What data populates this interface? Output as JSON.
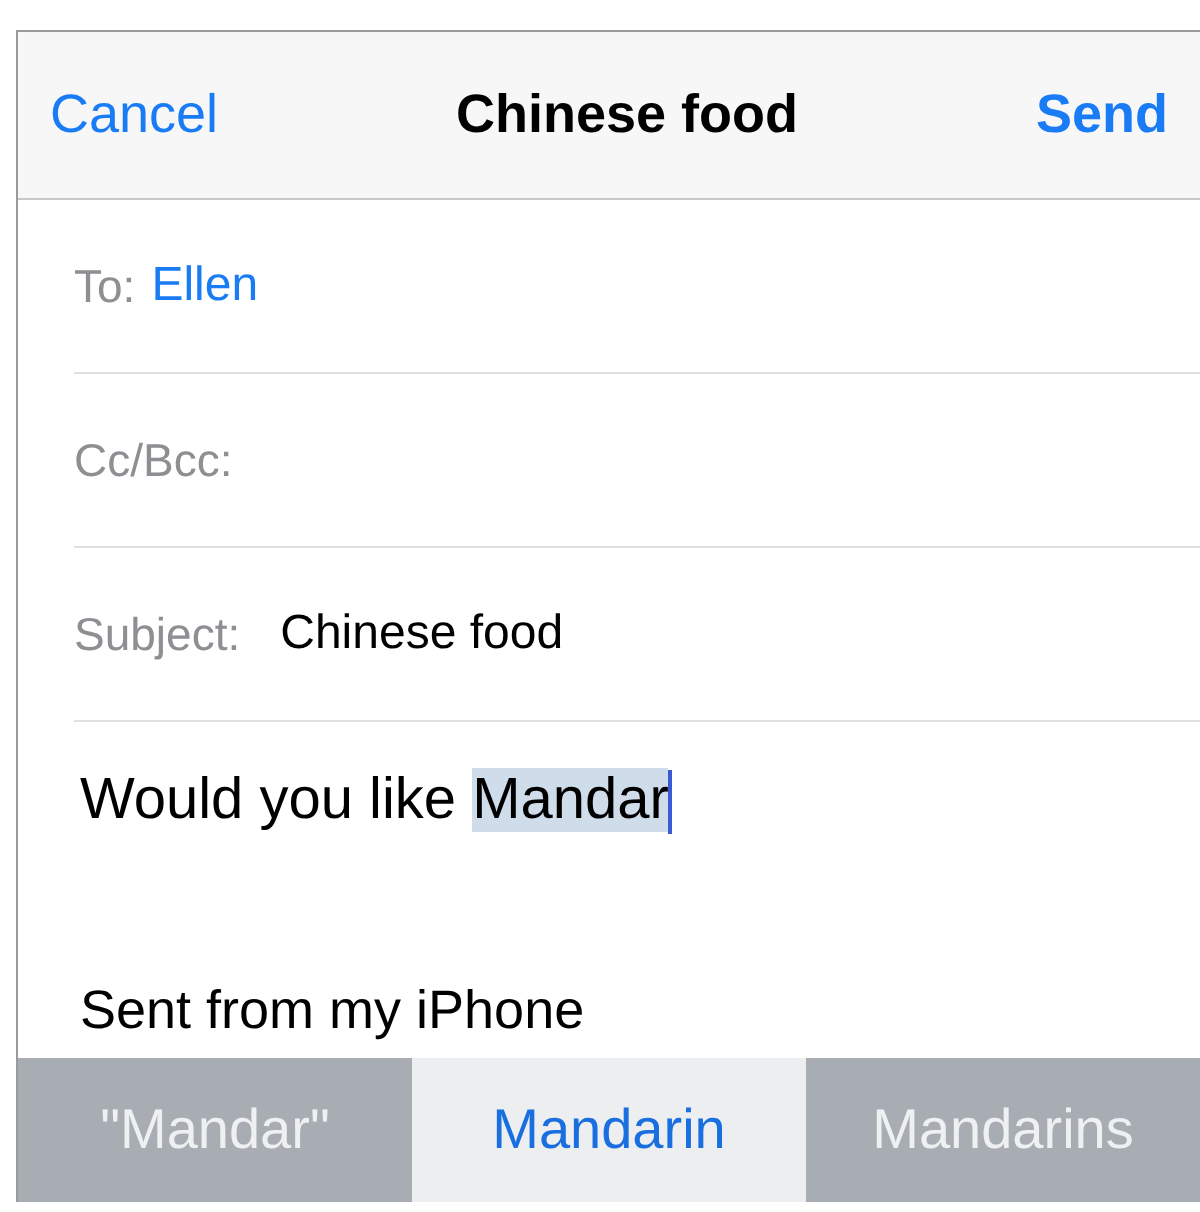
{
  "nav": {
    "cancel": "Cancel",
    "title": "Chinese food",
    "send": "Send"
  },
  "fields": [
    {
      "label": "To:",
      "value": "Ellen",
      "kind": "recipient"
    },
    {
      "label": "Cc/Bcc:",
      "kind": "recipient"
    },
    {
      "label": "Subject:",
      "value": "Chinese food",
      "kind": "subject"
    }
  ],
  "body": {
    "text": "Would you like ",
    "marked": "Mandar",
    "signature": "Sent from my iPhone"
  },
  "suggestions": [
    {
      "label": "\"Mandar\"",
      "selected": false
    },
    {
      "label": "Mandarin",
      "selected": true
    },
    {
      "label": "Mandarins",
      "selected": false
    }
  ]
}
